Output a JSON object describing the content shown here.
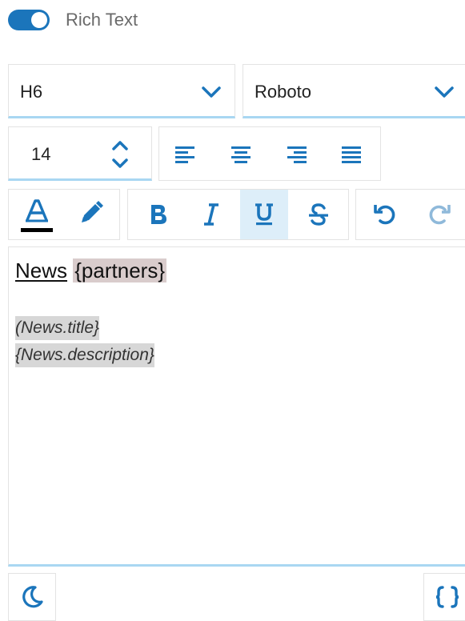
{
  "rich_text": {
    "label": "Rich Text",
    "enabled": true
  },
  "heading_select": {
    "value": "H6"
  },
  "font_select": {
    "value": "Roboto"
  },
  "font_size": {
    "value": "14"
  },
  "editor": {
    "line1_word": "News",
    "line1_token": "{partners}",
    "var1": "(News.title}",
    "var2": "{News.description}"
  },
  "colors": {
    "accent": "#1b75bb",
    "underline_focus": "#a9d7f2",
    "text_color_swatch": "#000000",
    "active_button_bg": "#ddeef9"
  },
  "icons": {
    "text_color": "text-color-icon",
    "highlight": "pencil-icon",
    "bold": "bold-icon",
    "italic": "italic-icon",
    "underline": "underline-icon",
    "strike": "strikethrough-icon",
    "undo": "undo-icon",
    "redo": "redo-icon",
    "dark_mode": "moon-icon",
    "variables": "braces-icon"
  }
}
